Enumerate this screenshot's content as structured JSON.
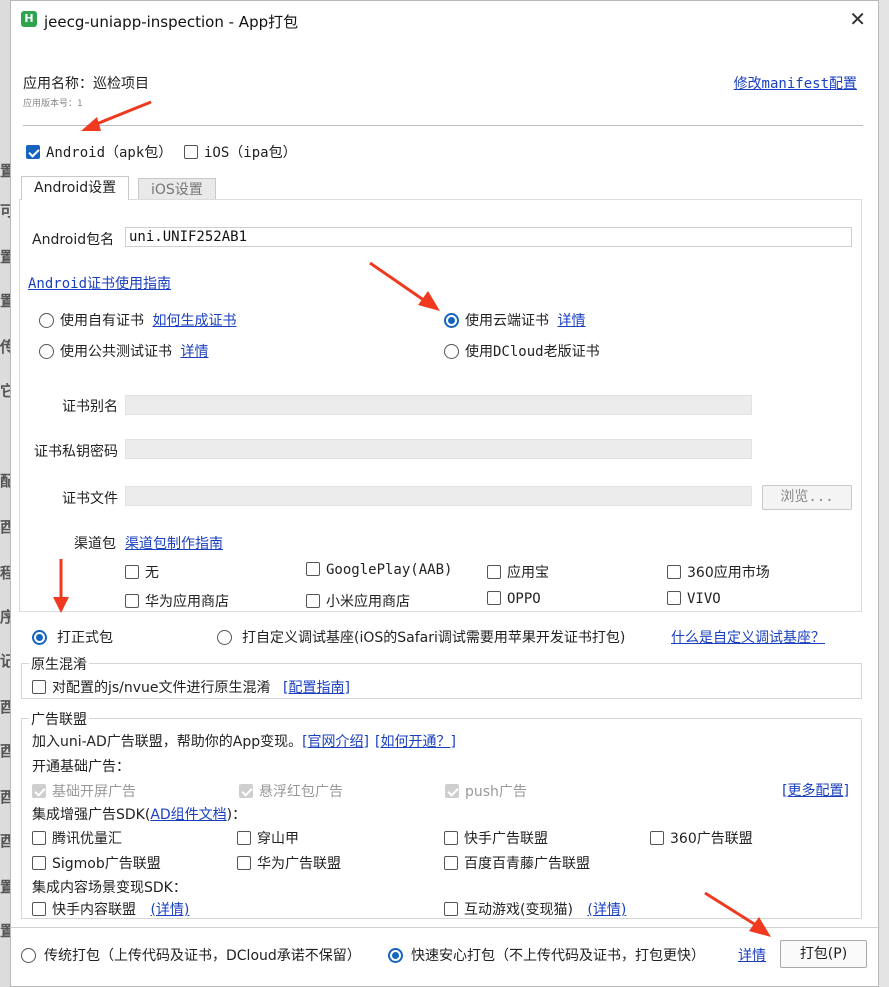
{
  "window": {
    "title": "jeecg-uniapp-inspection - App打包"
  },
  "app": {
    "name_label": "应用名称：巡检项目",
    "version_label": "应用版本号：1",
    "manifest_link": "修改manifest配置"
  },
  "platforms": {
    "android": "Android（apk包）",
    "ios": "iOS（ipa包）"
  },
  "tabs": {
    "android": "Android设置",
    "ios": "iOS设置"
  },
  "android": {
    "package_label": "Android包名",
    "package_value": "uni.UNIF252AB1",
    "cert_guide_link": "Android证书使用指南",
    "cert_own": "使用自有证书",
    "cert_own_link": "如何生成证书",
    "cert_cloud": "使用云端证书",
    "cert_cloud_link": "详情",
    "cert_public": "使用公共测试证书",
    "cert_public_link": "详情",
    "cert_dcloud_old": "使用DCloud老版证书",
    "alias_label": "证书别名",
    "key_password_label": "证书私钥密码",
    "file_label": "证书文件",
    "browse_button": "浏览...",
    "channel_label": "渠道包",
    "channel_link": "渠道包制作指南",
    "channels": [
      "无",
      "GooglePlay(AAB)",
      "应用宝",
      "360应用市场",
      "华为应用商店",
      "小米应用商店",
      "OPPO",
      "VIVO"
    ]
  },
  "build_type": {
    "formal": "打正式包",
    "custom_debug": "打自定义调试基座(iOS的Safari调试需要用苹果开发证书打包)",
    "custom_debug_link": "什么是自定义调试基座？"
  },
  "obfuscation": {
    "group_title": "原生混淆",
    "option": "对配置的js/nvue文件进行原生混淆",
    "guide_link": "[配置指南]"
  },
  "ads": {
    "group_title": "广告联盟",
    "intro": "加入uni-AD广告联盟，帮助你的App变现。",
    "official_link": "[官网介绍]",
    "how_link": "[如何开通？]",
    "basic_title": "开通基础广告：",
    "basic": [
      "基础开屏广告",
      "悬浮红包广告",
      "push广告"
    ],
    "more_link": "[更多配置]",
    "sdk_title_prefix": "集成增强广告SDK(",
    "sdk_doc_link": "AD组件文档",
    "sdk_title_suffix": ")：",
    "sdk": [
      "腾讯优量汇",
      "穿山甲",
      "快手广告联盟",
      "360广告联盟",
      "Sigmob广告联盟",
      "华为广告联盟",
      "百度百青藤广告联盟"
    ],
    "content_title": "集成内容场景变现SDK：",
    "content_kuaishou": "快手内容联盟",
    "content_kuaishou_link": "(详情)",
    "content_game": "互动游戏(变现猫)",
    "content_game_link": "(详情)"
  },
  "footer": {
    "traditional": "传统打包（上传代码及证书，DCloud承诺不保留）",
    "fast": "快速安心打包（不上传代码及证书，打包更快）",
    "details_link": "详情",
    "build_button": "打包(P)"
  },
  "colors": {
    "accent": "#1565c0",
    "link": "#1a3fc0",
    "arrow": "#f03a1f"
  }
}
